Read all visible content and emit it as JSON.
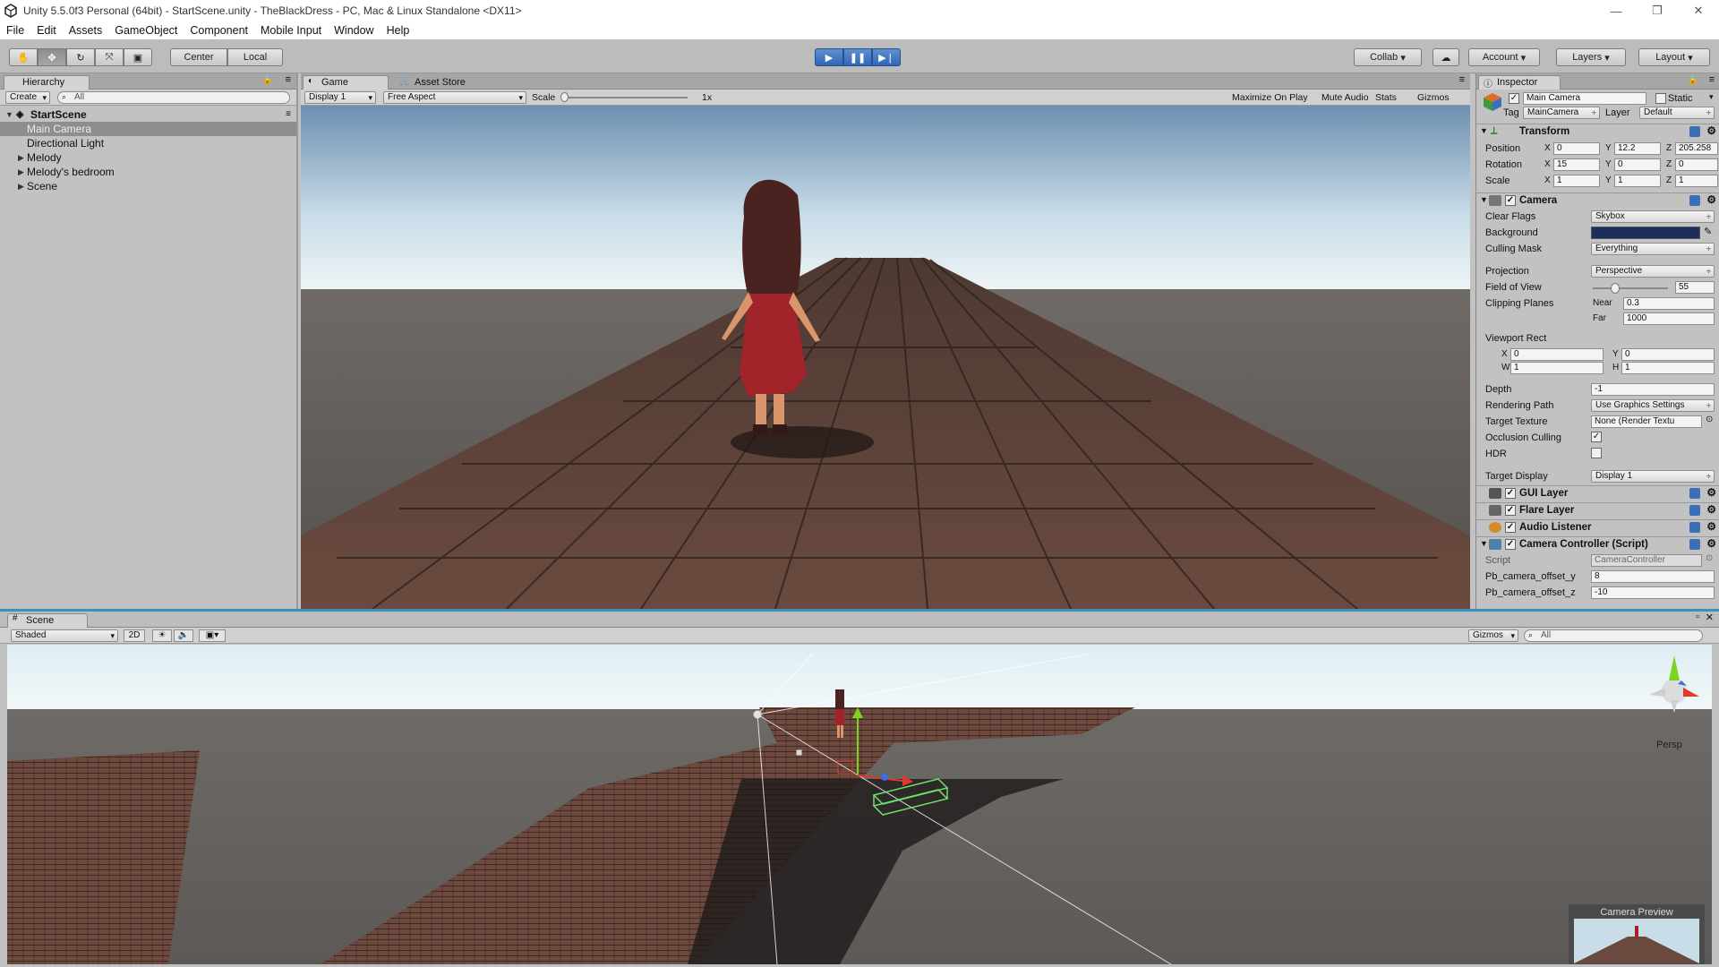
{
  "window": {
    "title": "Unity 5.5.0f3 Personal (64bit) - StartScene.unity - TheBlackDress - PC, Mac & Linux Standalone <DX11>"
  },
  "menu": [
    "File",
    "Edit",
    "Assets",
    "GameObject",
    "Component",
    "Mobile Input",
    "Window",
    "Help"
  ],
  "toolbar": {
    "center": "Center",
    "local": "Local",
    "collab": "Collab",
    "account": "Account",
    "layers": "Layers",
    "layout": "Layout"
  },
  "hierarchy": {
    "tab": "Hierarchy",
    "create": "Create",
    "search_placeholder": "All",
    "scene_name": "StartScene",
    "items": [
      "Main Camera",
      "Directional Light",
      "Melody",
      "Melody's bedroom",
      "Scene"
    ]
  },
  "game": {
    "tabs": [
      "Game",
      "Asset Store"
    ],
    "display": "Display 1",
    "aspect": "Free Aspect",
    "scale_label": "Scale",
    "scale_value": "1x",
    "buttons": [
      "Maximize On Play",
      "Mute Audio",
      "Stats",
      "Gizmos"
    ]
  },
  "inspector": {
    "tab": "Inspector",
    "object_name": "Main Camera",
    "static": "Static",
    "tag_label": "Tag",
    "tag": "MainCamera",
    "layer_label": "Layer",
    "layer": "Default",
    "transform": {
      "title": "Transform",
      "position": {
        "label": "Position",
        "x": "0",
        "y": "12.2",
        "z": "205.258"
      },
      "rotation": {
        "label": "Rotation",
        "x": "15",
        "y": "0",
        "z": "0"
      },
      "scale": {
        "label": "Scale",
        "x": "1",
        "y": "1",
        "z": "1"
      }
    },
    "camera": {
      "title": "Camera",
      "clear_flags": {
        "label": "Clear Flags",
        "value": "Skybox"
      },
      "background": {
        "label": "Background",
        "color": "#1c2f5a"
      },
      "culling_mask": {
        "label": "Culling Mask",
        "value": "Everything"
      },
      "projection": {
        "label": "Projection",
        "value": "Perspective"
      },
      "fov": {
        "label": "Field of View",
        "value": "55",
        "slider_fraction": 0.3
      },
      "clipping": {
        "label": "Clipping Planes",
        "near_label": "Near",
        "near": "0.3",
        "far_label": "Far",
        "far": "1000"
      },
      "viewport": {
        "label": "Viewport Rect",
        "x": "0",
        "y": "0",
        "w": "1",
        "h": "1"
      },
      "depth": {
        "label": "Depth",
        "value": "-1"
      },
      "rendering_path": {
        "label": "Rendering Path",
        "value": "Use Graphics Settings"
      },
      "target_texture": {
        "label": "Target Texture",
        "value": "None (Render Textu"
      },
      "occlusion": {
        "label": "Occlusion Culling",
        "checked": true
      },
      "hdr": {
        "label": "HDR",
        "checked": false
      },
      "target_display": {
        "label": "Target Display",
        "value": "Display 1"
      }
    },
    "components": [
      "GUI Layer",
      "Flare Layer",
      "Audio Listener",
      "Camera Controller (Script)"
    ],
    "script": {
      "label": "Script",
      "value": "CameraController"
    },
    "offset_y": {
      "label": "Pb_camera_offset_y",
      "value": "8"
    },
    "offset_z": {
      "label": "Pb_camera_offset_z",
      "value": "-10"
    }
  },
  "scene": {
    "tab": "Scene",
    "shading": "Shaded",
    "mode_2d": "2D",
    "gizmos": "Gizmos",
    "search_placeholder": "All",
    "persp": "Persp",
    "camera_preview": "Camera Preview"
  }
}
